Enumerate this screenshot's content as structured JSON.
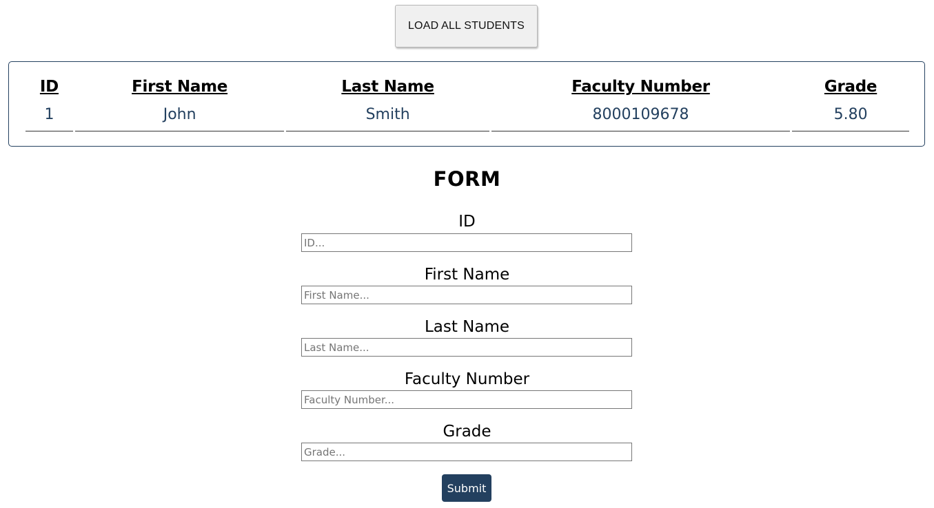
{
  "toolbar": {
    "load_label": "LOAD ALL STUDENTS"
  },
  "table": {
    "headers": [
      "ID",
      "First Name",
      "Last Name",
      "Faculty Number",
      "Grade"
    ],
    "rows": [
      [
        "1",
        "John",
        "Smith",
        "8000109678",
        "5.80"
      ]
    ]
  },
  "form": {
    "title": "FORM",
    "fields": [
      {
        "label": "ID",
        "placeholder": "ID...",
        "value": ""
      },
      {
        "label": "First Name",
        "placeholder": "First Name...",
        "value": ""
      },
      {
        "label": "Last Name",
        "placeholder": "Last Name...",
        "value": ""
      },
      {
        "label": "Faculty Number",
        "placeholder": "Faculty Number...",
        "value": ""
      },
      {
        "label": "Grade",
        "placeholder": "Grade...",
        "value": ""
      }
    ],
    "submit_label": "Submit"
  },
  "colors": {
    "accent": "#23405f",
    "button_bg": "#f0f0f0"
  }
}
